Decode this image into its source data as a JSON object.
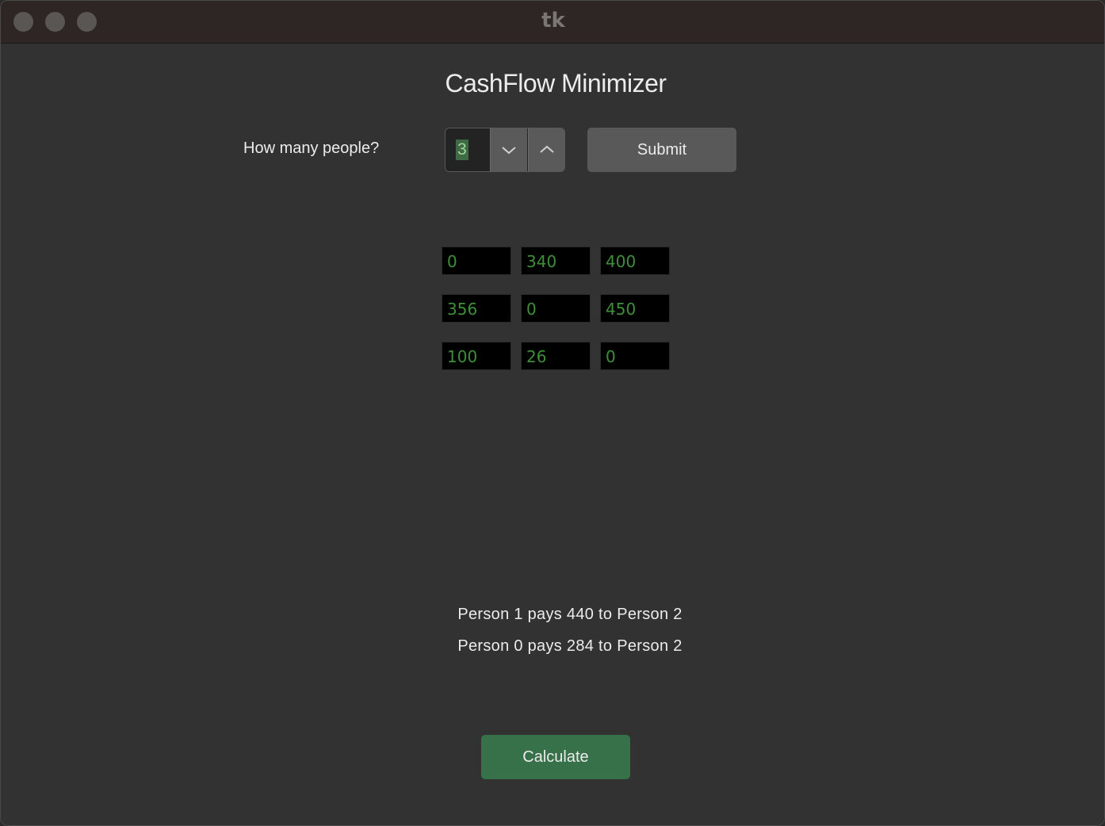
{
  "window": {
    "title": "tk"
  },
  "app": {
    "title": "CashFlow Minimizer"
  },
  "people_input": {
    "label": "How many people?",
    "value": "3",
    "submit_label": "Submit"
  },
  "matrix": {
    "rows": [
      [
        "0",
        "340",
        "400"
      ],
      [
        "356",
        "0",
        "450"
      ],
      [
        "100",
        "26",
        "0"
      ]
    ]
  },
  "results": [
    "Person 1 pays 440 to Person 2",
    "Person 0 pays 284 to Person 2"
  ],
  "actions": {
    "calculate_label": "Calculate"
  },
  "icons": {
    "spin_down": "chevron-down-icon",
    "spin_up": "chevron-up-icon"
  },
  "colors": {
    "background": "#323232",
    "cell_text": "#3f8f3a",
    "calculate_button": "#37714a",
    "submit_button": "#595959"
  }
}
